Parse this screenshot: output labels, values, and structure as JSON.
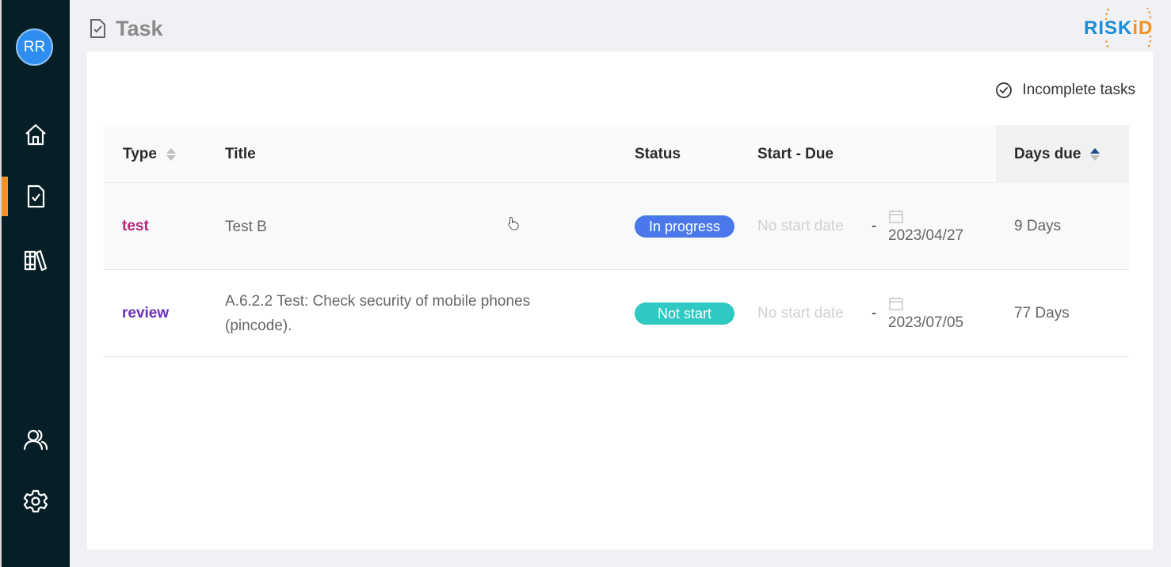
{
  "user": {
    "initials": "RR"
  },
  "sidebar": {
    "items": [
      {
        "name": "home",
        "icon": "home-icon"
      },
      {
        "name": "task",
        "icon": "task-document-icon",
        "active": true
      },
      {
        "name": "library",
        "icon": "library-books-icon"
      },
      {
        "name": "users",
        "icon": "users-icon"
      },
      {
        "name": "settings",
        "icon": "gear-icon"
      }
    ]
  },
  "header": {
    "title": "Task",
    "logo_text_main": "RISK",
    "logo_text_accent": "iD"
  },
  "filter": {
    "label": "Incomplete tasks"
  },
  "table": {
    "columns": {
      "type": "Type",
      "title": "Title",
      "status": "Status",
      "start_due": "Start - Due",
      "days_due": "Days due"
    },
    "rows": [
      {
        "type": "test",
        "type_color": "#b0277f",
        "title": "Test B",
        "status": "In progress",
        "status_color": "#4a78ea",
        "start": "No start date",
        "dash": "-",
        "due": "2023/04/27",
        "days": "9 Days"
      },
      {
        "type": "review",
        "type_color": "#6a2fc0",
        "title": "A.6.2.2 Test: Check security of mobile phones (pincode).",
        "status": "Not start",
        "status_color": "#2ec9c2",
        "start": "No start date",
        "dash": "-",
        "due": "2023/07/05",
        "days": "77 Days"
      }
    ]
  },
  "colors": {
    "sidebar_bg": "#061f26",
    "active_indicator": "#f39220",
    "brand_blue": "#1a8cd8",
    "brand_orange": "#f39220"
  }
}
